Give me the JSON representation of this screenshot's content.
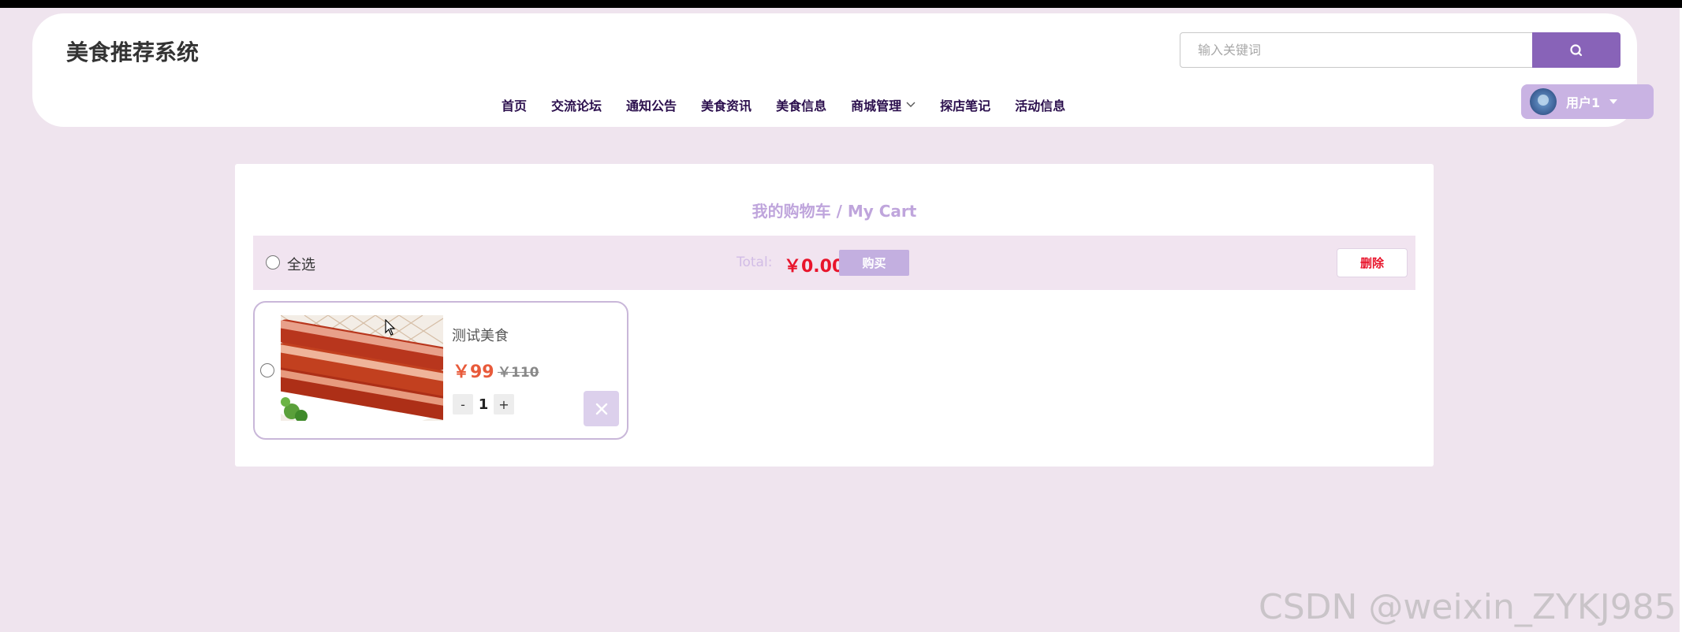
{
  "header": {
    "logo": "美食推荐系统",
    "search": {
      "placeholder": "输入关键词",
      "button_icon": "search-icon"
    },
    "nav": [
      {
        "label": "首页"
      },
      {
        "label": "交流论坛"
      },
      {
        "label": "通知公告"
      },
      {
        "label": "美食资讯"
      },
      {
        "label": "美食信息"
      },
      {
        "label": "商城管理",
        "has_dropdown": true
      },
      {
        "label": "探店笔记"
      },
      {
        "label": "活动信息"
      }
    ],
    "user": {
      "label": "用户1",
      "avatar_icon": "avatar-icon"
    }
  },
  "cart": {
    "title": "我的购物车 / My Cart",
    "toolbar": {
      "select_all_label": "全选",
      "total_label": "Total:",
      "total_value": "￥0.00",
      "buy_label": "购买",
      "delete_label": "删除"
    },
    "items": [
      {
        "name": "测试美食",
        "price": "￥99",
        "original_price": "￥110",
        "quantity": "1",
        "minus_label": "-",
        "plus_label": "+",
        "selected": false
      }
    ]
  },
  "colors": {
    "accent": "#8863b8",
    "accent_light": "#c3afe0",
    "price_red": "#e8142b",
    "page_background": "#efe4ee"
  },
  "watermark": "CSDN @weixin_ZYKJ985"
}
